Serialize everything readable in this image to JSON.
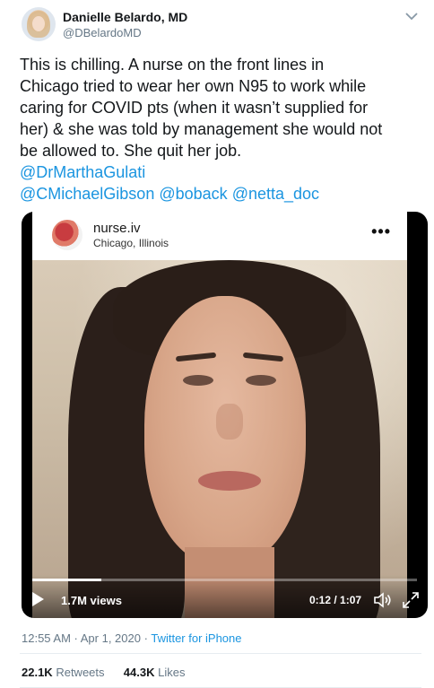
{
  "author": {
    "name": "Danielle Belardo, MD",
    "handle": "@DBelardoMD"
  },
  "tweet": {
    "text": "This is chilling. A nurse on the front lines in\nChicago tried to wear her own N95 to work while\ncaring for COVID pts (when it wasn’t supplied for\nher) & she was told by management she would not\nbe allowed to. She quit her job.",
    "mentions": [
      "@DrMarthaGulati",
      "@CMichaelGibson",
      "@boback",
      "@netta_doc"
    ]
  },
  "media": {
    "ig_username": "nurse.iv",
    "ig_location": "Chicago, Illinois",
    "ig_more": "•••",
    "views": "1.7M views",
    "time": "0:12 / 1:07",
    "progress_fraction": 0.18
  },
  "meta": {
    "timestamp": "12:55 AM · Apr 1, 2020",
    "separator": "·",
    "source": "Twitter for iPhone"
  },
  "stats": {
    "retweets_count": "22.1K",
    "retweets_label": "Retweets",
    "likes_count": "44.3K",
    "likes_label": "Likes"
  },
  "colors": {
    "link": "#1b95e0",
    "text": "#14171a",
    "muted": "#657786"
  },
  "icons": {
    "caret": "chevron-down-icon",
    "play": "play-icon",
    "volume": "volume-icon",
    "fullscreen": "fullscreen-icon",
    "more": "more-icon"
  }
}
